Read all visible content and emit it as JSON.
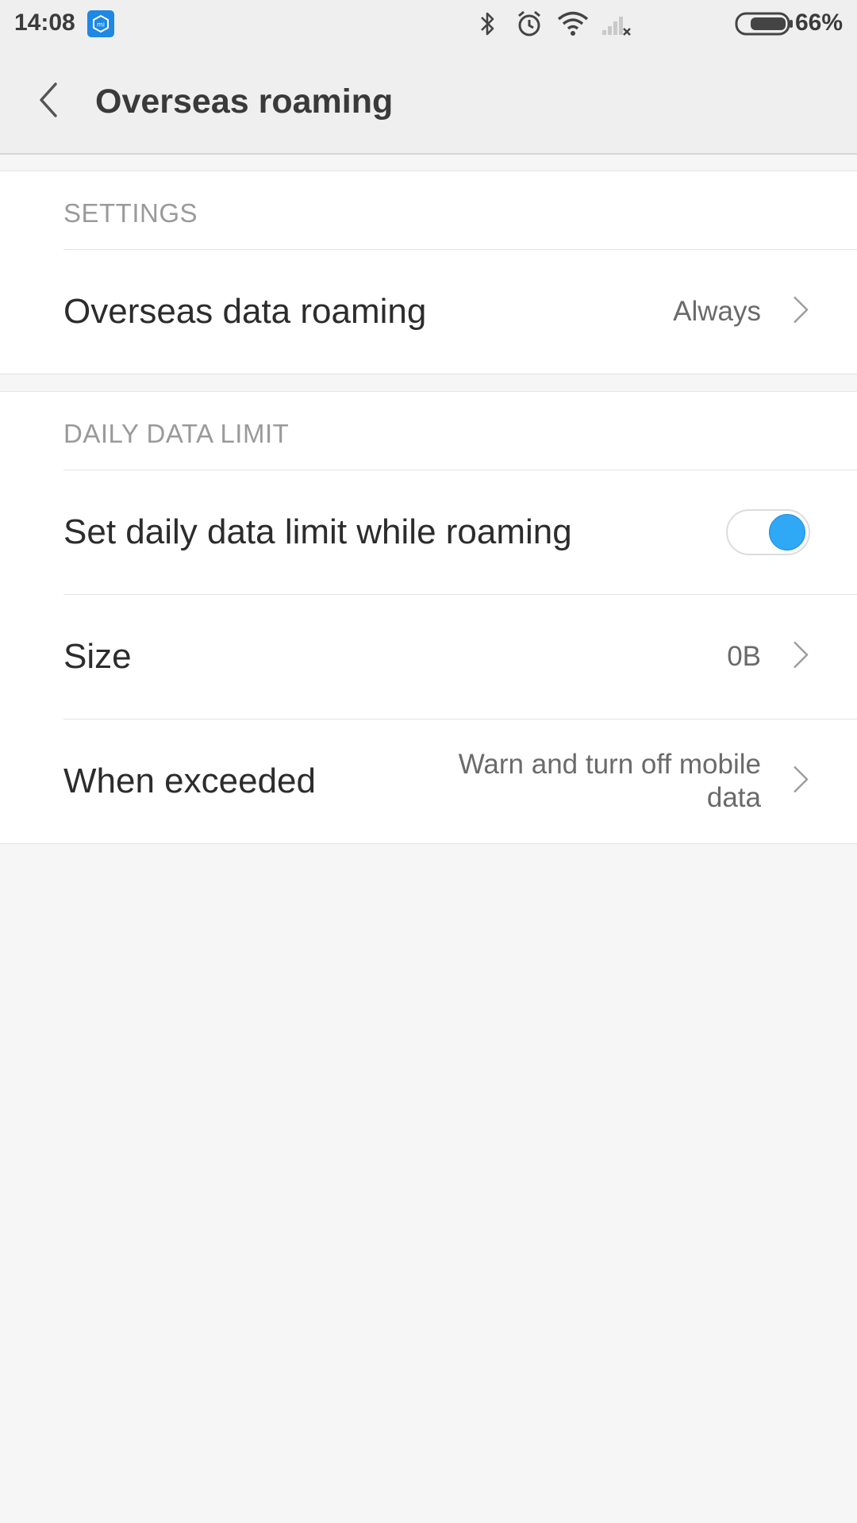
{
  "status_bar": {
    "time": "14:08",
    "battery_percent": "66%",
    "icons": [
      "mi-app-icon",
      "bluetooth-icon",
      "alarm-icon",
      "wifi-icon",
      "signal-no-service-icon",
      "battery-icon"
    ]
  },
  "header": {
    "title": "Overseas roaming",
    "back_icon": "chevron-left-icon"
  },
  "sections": {
    "settings": {
      "header": "SETTINGS",
      "overseas_data_roaming": {
        "label": "Overseas data roaming",
        "value": "Always"
      }
    },
    "daily_limit": {
      "header": "DAILY DATA LIMIT",
      "set_limit": {
        "label": "Set daily data limit while roaming",
        "enabled": true
      },
      "size": {
        "label": "Size",
        "value": "0B"
      },
      "when_exceeded": {
        "label": "When exceeded",
        "value": "Warn and turn off mobile data"
      }
    }
  },
  "colors": {
    "accent": "#2fa8f5",
    "header_bg": "#efefef",
    "page_bg": "#f6f6f6"
  }
}
